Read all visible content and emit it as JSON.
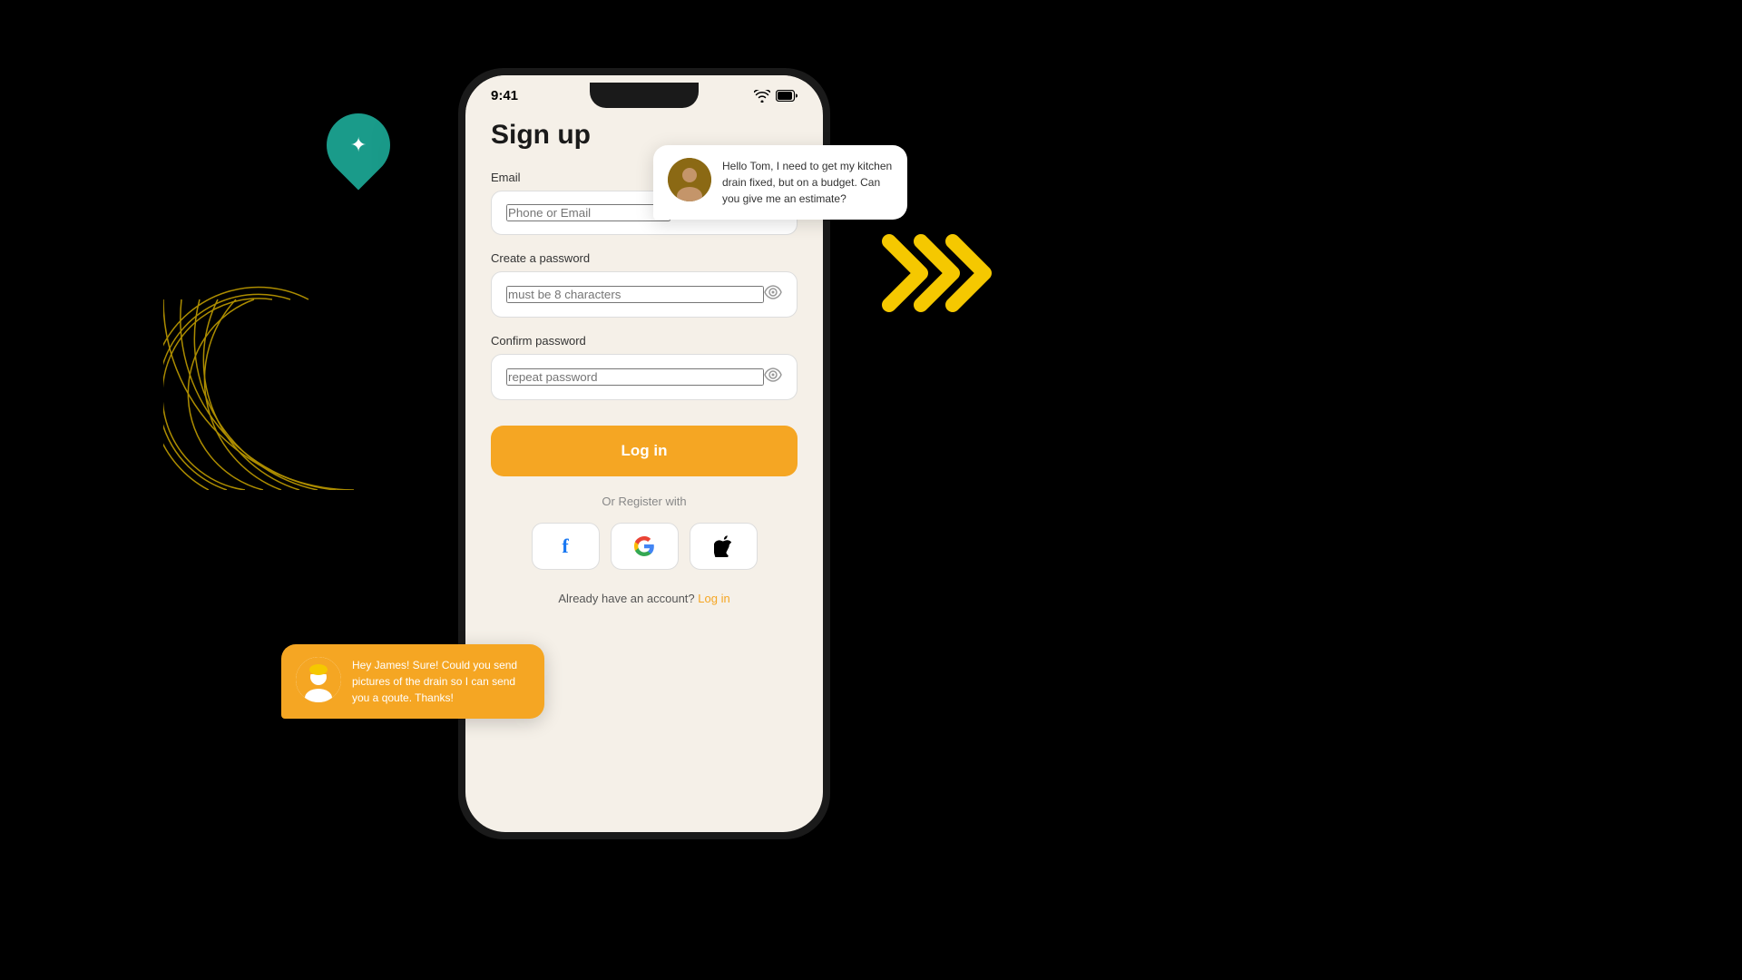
{
  "page": {
    "background": "#000000"
  },
  "status_bar": {
    "time": "9:41",
    "wifi": "wifi",
    "battery": "battery"
  },
  "form": {
    "title": "Sign up",
    "email_label": "Email",
    "email_placeholder": "Phone or Email",
    "password_label": "Create a password",
    "password_placeholder": "must be 8 characters",
    "confirm_label": "Confirm password",
    "confirm_placeholder": "repeat password",
    "login_button": "Log in",
    "or_register": "Or Register with",
    "already_text": "Already have an account?",
    "login_link": "Log in"
  },
  "chat_top": {
    "text": "Hello Tom, I need to get my kitchen drain fixed, but on a budget. Can you give me an estimate?"
  },
  "chat_bottom": {
    "text": "Hey James! Sure! Could you send pictures of the drain so I can send you a qoute. Thanks!"
  },
  "social": {
    "facebook": "f",
    "google": "G",
    "apple": ""
  }
}
